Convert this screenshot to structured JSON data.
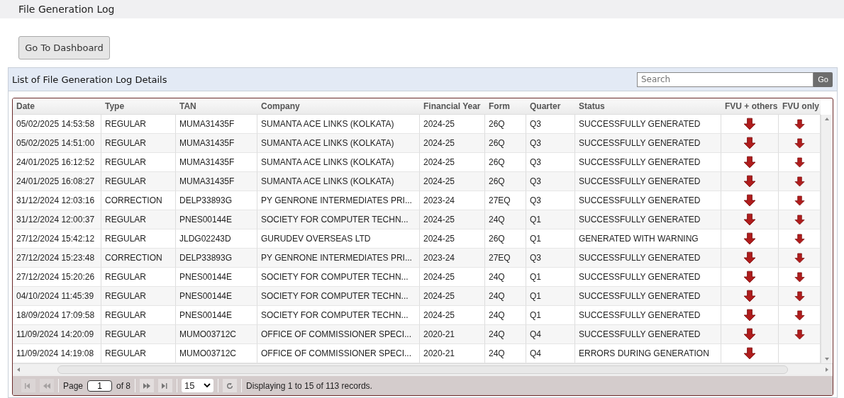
{
  "page_title": "File Generation Log",
  "dashboard_button": "Go To Dashboard",
  "panel": {
    "title": "List of File Generation Log Details",
    "search": {
      "placeholder": "Search"
    },
    "search_button": "Go"
  },
  "table": {
    "columns": [
      "Date",
      "Type",
      "TAN",
      "Company",
      "Financial Year",
      "Form",
      "Quarter",
      "Status",
      "FVU + others",
      "FVU only"
    ],
    "rows": [
      {
        "date": "05/02/2025 14:53:58",
        "type": "REGULAR",
        "tan": "MUMA31435F",
        "company": "SUMANTA ACE LINKS (KOLKATA)",
        "financial_year": "2024-25",
        "form": "26Q",
        "quarter": "Q3",
        "status": "SUCCESSFULLY GENERATED",
        "fvu_others": true,
        "fvu_only": true
      },
      {
        "date": "05/02/2025 14:51:00",
        "type": "REGULAR",
        "tan": "MUMA31435F",
        "company": "SUMANTA ACE LINKS (KOLKATA)",
        "financial_year": "2024-25",
        "form": "26Q",
        "quarter": "Q3",
        "status": "SUCCESSFULLY GENERATED",
        "fvu_others": true,
        "fvu_only": true
      },
      {
        "date": "24/01/2025 16:12:52",
        "type": "REGULAR",
        "tan": "MUMA31435F",
        "company": "SUMANTA ACE LINKS (KOLKATA)",
        "financial_year": "2024-25",
        "form": "26Q",
        "quarter": "Q3",
        "status": "SUCCESSFULLY GENERATED",
        "fvu_others": true,
        "fvu_only": true
      },
      {
        "date": "24/01/2025 16:08:27",
        "type": "REGULAR",
        "tan": "MUMA31435F",
        "company": "SUMANTA ACE LINKS (KOLKATA)",
        "financial_year": "2024-25",
        "form": "26Q",
        "quarter": "Q3",
        "status": "SUCCESSFULLY GENERATED",
        "fvu_others": true,
        "fvu_only": true
      },
      {
        "date": "31/12/2024 12:03:16",
        "type": "CORRECTION",
        "tan": "DELP33893G",
        "company": "PY GENRONE INTERMEDIATES PRI...",
        "financial_year": "2023-24",
        "form": "27EQ",
        "quarter": "Q3",
        "status": "SUCCESSFULLY GENERATED",
        "fvu_others": true,
        "fvu_only": true
      },
      {
        "date": "31/12/2024 12:00:37",
        "type": "REGULAR",
        "tan": "PNES00144E",
        "company": "SOCIETY FOR COMPUTER TECHN...",
        "financial_year": "2024-25",
        "form": "24Q",
        "quarter": "Q1",
        "status": "SUCCESSFULLY GENERATED",
        "fvu_others": true,
        "fvu_only": true
      },
      {
        "date": "27/12/2024 15:42:12",
        "type": "REGULAR",
        "tan": "JLDG02243D",
        "company": "GURUDEV OVERSEAS LTD",
        "financial_year": "2024-25",
        "form": "26Q",
        "quarter": "Q1",
        "status": "GENERATED WITH WARNING",
        "fvu_others": true,
        "fvu_only": true
      },
      {
        "date": "27/12/2024 15:23:48",
        "type": "CORRECTION",
        "tan": "DELP33893G",
        "company": "PY GENRONE INTERMEDIATES PRI...",
        "financial_year": "2023-24",
        "form": "27EQ",
        "quarter": "Q3",
        "status": "SUCCESSFULLY GENERATED",
        "fvu_others": true,
        "fvu_only": true
      },
      {
        "date": "27/12/2024 15:20:26",
        "type": "REGULAR",
        "tan": "PNES00144E",
        "company": "SOCIETY FOR COMPUTER TECHN...",
        "financial_year": "2024-25",
        "form": "24Q",
        "quarter": "Q1",
        "status": "SUCCESSFULLY GENERATED",
        "fvu_others": true,
        "fvu_only": true
      },
      {
        "date": "04/10/2024 11:45:39",
        "type": "REGULAR",
        "tan": "PNES00144E",
        "company": "SOCIETY FOR COMPUTER TECHN...",
        "financial_year": "2024-25",
        "form": "24Q",
        "quarter": "Q1",
        "status": "SUCCESSFULLY GENERATED",
        "fvu_others": true,
        "fvu_only": true
      },
      {
        "date": "18/09/2024 17:09:58",
        "type": "REGULAR",
        "tan": "PNES00144E",
        "company": "SOCIETY FOR COMPUTER TECHN...",
        "financial_year": "2024-25",
        "form": "24Q",
        "quarter": "Q1",
        "status": "SUCCESSFULLY GENERATED",
        "fvu_others": true,
        "fvu_only": true
      },
      {
        "date": "11/09/2024 14:20:09",
        "type": "REGULAR",
        "tan": "MUMO03712C",
        "company": "OFFICE OF COMMISSIONER SPECI...",
        "financial_year": "2020-21",
        "form": "24Q",
        "quarter": "Q4",
        "status": "SUCCESSFULLY GENERATED",
        "fvu_others": true,
        "fvu_only": true
      },
      {
        "date": "11/09/2024 14:19:08",
        "type": "REGULAR",
        "tan": "MUMO03712C",
        "company": "OFFICE OF COMMISSIONER SPECI...",
        "financial_year": "2020-21",
        "form": "24Q",
        "quarter": "Q4",
        "status": "ERRORS DURING GENERATION",
        "fvu_others": true,
        "fvu_only": false
      }
    ]
  },
  "pager": {
    "page_label": "Page",
    "page": "1",
    "of_label": "of 8",
    "page_size": "15",
    "summary": "Displaying 1 to 15 of 113 records."
  }
}
